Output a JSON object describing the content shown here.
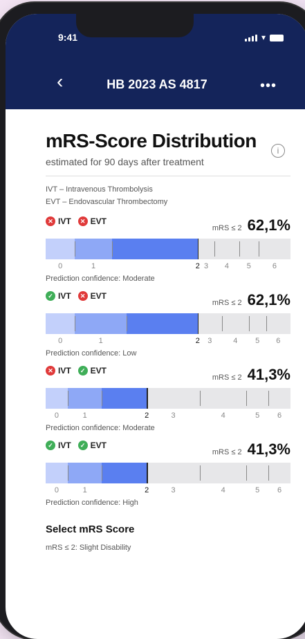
{
  "status_bar": {
    "time": "9:41"
  },
  "header": {
    "title": "HB 2023 AS 4817",
    "back_icon": "chevron-left-icon",
    "more_icon": "more-icon"
  },
  "main": {
    "heading": "mRS-Score Distribution",
    "info_icon": "i",
    "subtitle": "estimated for 90 days after treatment",
    "legend": [
      "IVT – Intravenous Thrombolysis",
      "EVT – Endovascular Thrombectomy"
    ]
  },
  "score_labels": [
    "0",
    "1",
    "2",
    "3",
    "4",
    "5",
    "6"
  ],
  "scenarios": [
    {
      "ivt": "IVT",
      "evt": "EVT",
      "ivt_status": "x",
      "evt_status": "x",
      "score_label": "mRS ≤ 2",
      "score_value": "62,1%",
      "cumulative": [
        0.12,
        0.27,
        0.621,
        0.69,
        0.79,
        0.87,
        1.0
      ],
      "confidence": "Prediction confidence: Moderate"
    },
    {
      "ivt": "IVT",
      "evt": "EVT",
      "ivt_status": "ok",
      "evt_status": "x",
      "score_label": "mRS ≤ 2",
      "score_value": "62,1%",
      "cumulative": [
        0.12,
        0.33,
        0.621,
        0.72,
        0.83,
        0.9,
        1.0
      ],
      "confidence": "Prediction confidence: Low"
    },
    {
      "ivt": "IVT",
      "evt": "EVT",
      "ivt_status": "x",
      "evt_status": "ok",
      "score_label": "mRS ≤ 2",
      "score_value": "41,3%",
      "cumulative": [
        0.09,
        0.23,
        0.413,
        0.63,
        0.82,
        0.91,
        1.0
      ],
      "confidence": "Prediction confidence: Moderate"
    },
    {
      "ivt": "IVT",
      "evt": "EVT",
      "ivt_status": "ok",
      "evt_status": "ok",
      "score_label": "mRS ≤ 2",
      "score_value": "41,3%",
      "cumulative": [
        0.09,
        0.23,
        0.413,
        0.63,
        0.82,
        0.91,
        1.0
      ],
      "confidence": "Prediction confidence: High"
    }
  ],
  "select": {
    "title": "Select mRS Score",
    "current": "mRS ≤ 2: Slight Disability"
  }
}
